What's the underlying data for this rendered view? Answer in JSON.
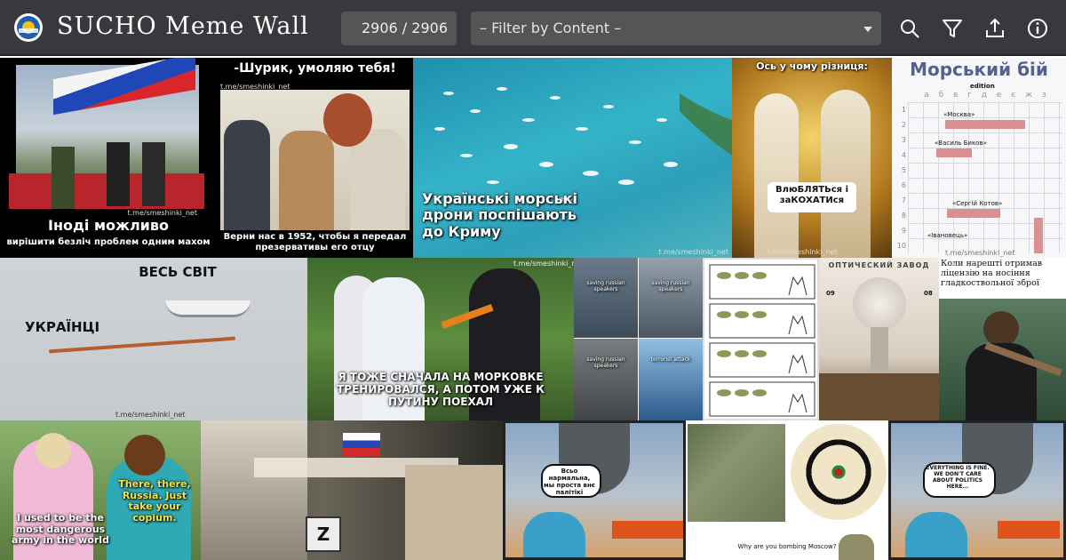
{
  "header": {
    "title": "SUCHO Meme Wall",
    "counter": "2906 / 2906",
    "filter_placeholder": "– Filter by Content –"
  },
  "icons": [
    "search-icon",
    "filter-icon",
    "share-icon",
    "info-icon"
  ],
  "colors": {
    "topbar": "#38393c",
    "input": "#545557",
    "sea": "#2fa6c9"
  },
  "memes": {
    "m1": {
      "line1": "Іноді можливо",
      "line2": "вирішити безліч проблем одним махом",
      "wm": "t.me/smeshinki_net"
    },
    "m2": {
      "top": "-Шурик, умоляю тебя!",
      "wm": "t.me/smeshinki_net",
      "bottom": "Верни нас в 1952, чтобы я передал презервативы его отцу"
    },
    "m3": {
      "text": "Українські морські дрони поспішають до Криму",
      "wm": "t.me/smeshinki_net"
    },
    "m4": {
      "top": "Ось у чому різниця:",
      "mid": "ВлюБЛЯТЬся і заКОХАТИся",
      "wm": "t.me/smeshinki_net"
    },
    "m5": {
      "title": "Морський бій",
      "sub": "edition",
      "cols": "а б в г д е є ж з",
      "rows": [
        "1",
        "2",
        "3",
        "4",
        "5",
        "6",
        "7",
        "8",
        "9",
        "10"
      ],
      "ship1": "«Москва»",
      "ship2": "«Василь Биков»",
      "ship3": "«Сергій Котов»",
      "ship4": "«Івановець»",
      "wm": "t.me/smeshinki_net"
    },
    "m6": {
      "top": "ВЕСЬ СВІТ",
      "left": "УКРАЇНЦІ",
      "wm": "t.me/smeshinki_net"
    },
    "m7": {
      "text": "Я ТОЖЕ СНАЧАЛА НА МОРКОВКЕ ТРЕНИРОВАЛСЯ, А ПОТОМ УЖЕ К ПУТИНУ ПОЕХАЛ",
      "wm": "t.me/smeshinki_net"
    },
    "m8": {
      "t1": "saving russian speakers",
      "t2": "saving russian speakers",
      "t3": "saving russian speakers",
      "t4": "terrorist attack"
    },
    "m10": {
      "title": "ОПТИЧЕСКИЙ ЗАВОД",
      "l": "09",
      "r": "08"
    },
    "m11": {
      "text": "Коли нарешті отримав ліцензію на носіння гладкоствольної зброї"
    },
    "m12": {
      "text": "I used to be the most dangerous army in the world",
      "reply": "There, there, Russia. Just take your copium."
    },
    "m14": {
      "bubble": "Всьо нармальна, мы проста внє палітікі"
    },
    "m15": {
      "caption": "Why are you bombing Moscow?",
      "dart": "20  1  18  4  13  6  10  15  2  17  3  19  7  16  8  11  14  9  12  5"
    },
    "m16": {
      "bubble": "EVERYTHING IS FINE. WE DON'T CARE ABOUT POLITICS HERE..."
    }
  }
}
